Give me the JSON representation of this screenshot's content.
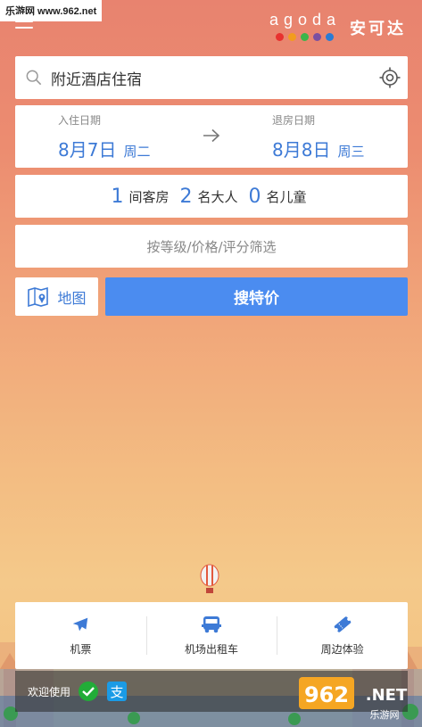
{
  "watermark_top": "乐游网 www.962.net",
  "brand": {
    "word": "agoda",
    "chinese": "安可达",
    "dot_colors": [
      "#e8312f",
      "#f29c1e",
      "#3bb54a",
      "#7b4fa1",
      "#2a7bd4"
    ]
  },
  "search": {
    "placeholder": "附近酒店住宿"
  },
  "dates": {
    "checkin_label": "入住日期",
    "checkin_date": "8月7日",
    "checkin_week": "周二",
    "checkout_label": "退房日期",
    "checkout_date": "8月8日",
    "checkout_week": "周三"
  },
  "guests": {
    "rooms": "1",
    "rooms_label": "间客房",
    "adults": "2",
    "adults_label": "名大人",
    "children": "0",
    "children_label": "名儿童"
  },
  "filter": {
    "label": "按等级/价格/评分筛选"
  },
  "actions": {
    "map_label": "地图",
    "search_label": "搜特价"
  },
  "services": [
    {
      "label": "机票",
      "icon": "airplane-icon"
    },
    {
      "label": "机场出租车",
      "icon": "bus-icon"
    },
    {
      "label": "周边体验",
      "icon": "ticket-icon"
    }
  ],
  "payment": {
    "label": "欢迎使用",
    "methods": [
      "wechat-pay-icon",
      "alipay-icon"
    ]
  },
  "watermark_bottom": {
    "logo": "962",
    "dot": ".NET",
    "sub": "乐游网"
  },
  "colors": {
    "accent": "#3d7ad6",
    "button": "#4b8cf0"
  }
}
